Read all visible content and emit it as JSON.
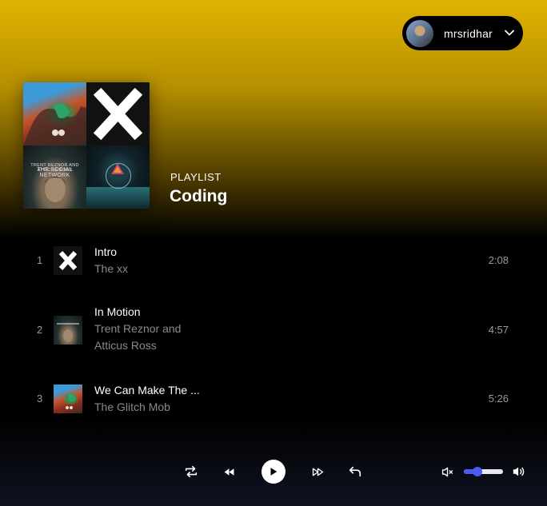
{
  "user": {
    "name": "mrsridhar"
  },
  "playlist": {
    "type_label": "PLAYLIST",
    "name": "Coding",
    "cover_caption_line1": "TRENT REZNOR AND ATTICUS ROSS",
    "cover_caption_line2": "THE SOCIAL NETWORK"
  },
  "tracks": [
    {
      "number": "1",
      "title": "Intro",
      "artist": "The xx",
      "duration": "2:08"
    },
    {
      "number": "2",
      "title": "In Motion",
      "artist": "Trent Reznor and Atticus Ross",
      "duration": "4:57"
    },
    {
      "number": "3",
      "title": "We Can Make The ...",
      "artist": "The Glitch Mob",
      "duration": "5:26"
    }
  ],
  "player": {
    "volume_fraction": 0.35,
    "icons": [
      "repeat-icon",
      "previous-icon",
      "play-icon",
      "next-icon",
      "back-icon",
      "mute-icon",
      "volume-icon"
    ]
  },
  "colors": {
    "accent": "#4a5bf0",
    "header_gradient_top": "#e0b300"
  }
}
